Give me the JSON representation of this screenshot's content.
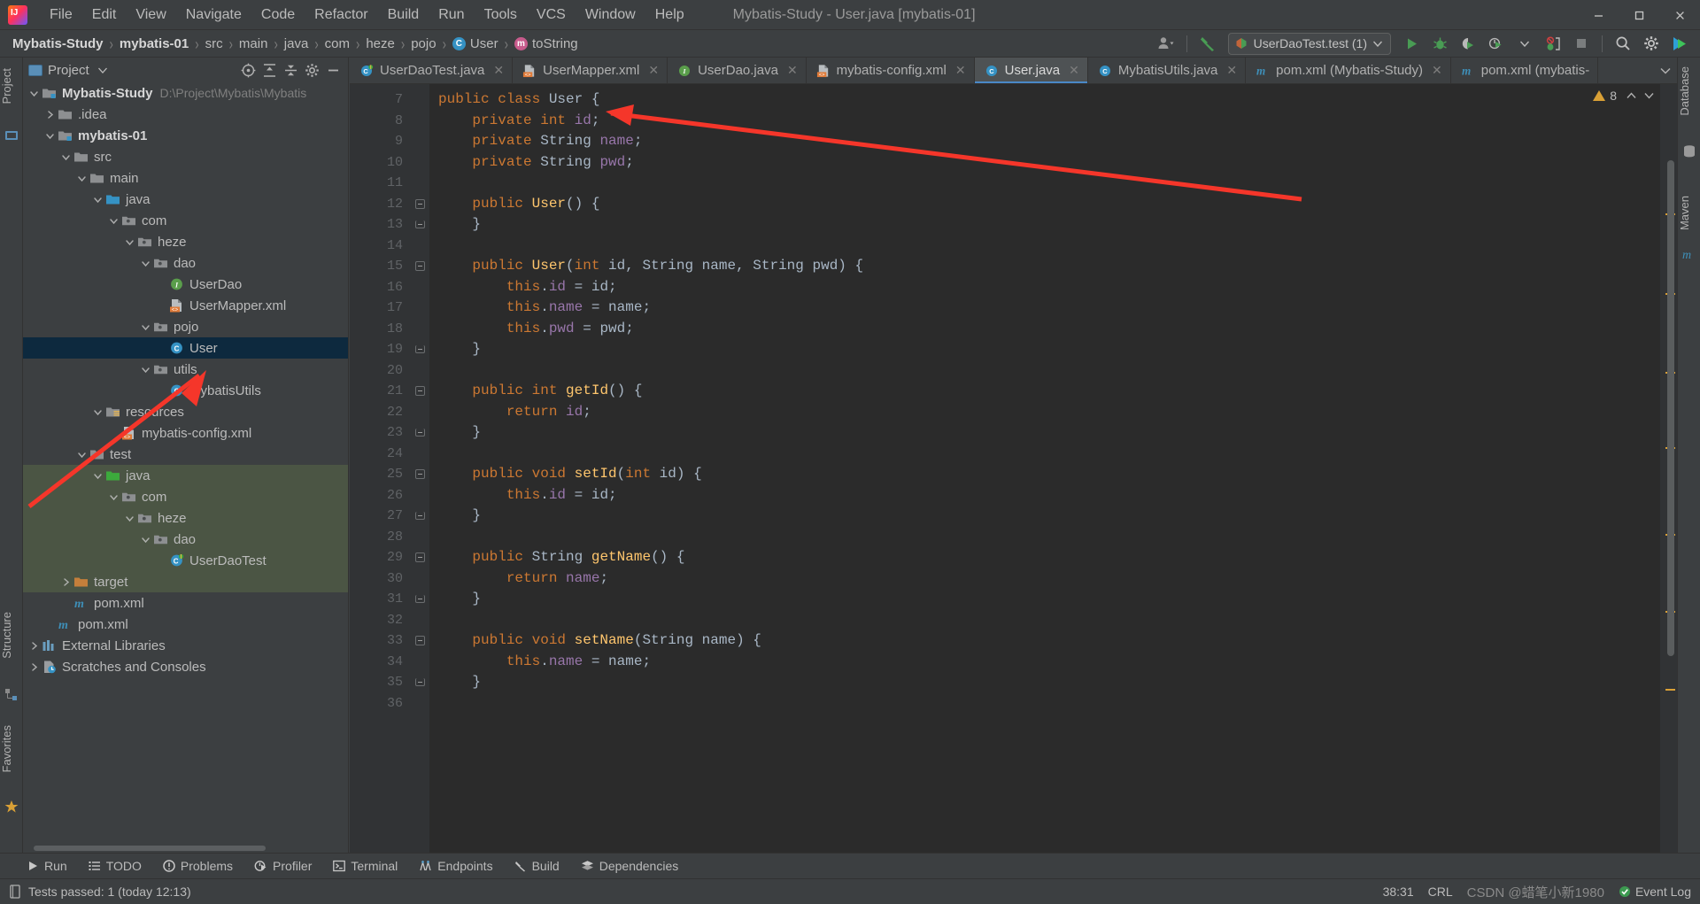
{
  "window": {
    "title": "Mybatis-Study - User.java [mybatis-01]",
    "minimize": "–",
    "maximize": "❐",
    "close": "✕"
  },
  "menu": [
    {
      "label": "File"
    },
    {
      "label": "Edit"
    },
    {
      "label": "View"
    },
    {
      "label": "Navigate"
    },
    {
      "label": "Code"
    },
    {
      "label": "Refactor"
    },
    {
      "label": "Build"
    },
    {
      "label": "Run"
    },
    {
      "label": "Tools"
    },
    {
      "label": "VCS"
    },
    {
      "label": "Window"
    },
    {
      "label": "Help"
    }
  ],
  "breadcrumb": [
    {
      "label": "Mybatis-Study",
      "icon": "none",
      "bold": true
    },
    {
      "label": "mybatis-01",
      "icon": "none",
      "bold": true
    },
    {
      "label": "src",
      "icon": "folder"
    },
    {
      "label": "main",
      "icon": "folder"
    },
    {
      "label": "java",
      "icon": "folder"
    },
    {
      "label": "com",
      "icon": "folder"
    },
    {
      "label": "heze",
      "icon": "folder"
    },
    {
      "label": "pojo",
      "icon": "folder"
    },
    {
      "label": "User",
      "icon": "class",
      "glyph": "C"
    },
    {
      "label": "toString",
      "icon": "method",
      "glyph": "m"
    }
  ],
  "run_toolbar": {
    "config_name": "UserDaoTest.test (1)",
    "run_tooltip": "Run",
    "debug_tooltip": "Debug",
    "coverage_tooltip": "Run with Coverage",
    "profiler_tooltip": "Profiler",
    "stop_tooltip": "Stop",
    "search_tooltip": "Search Everywhere",
    "settings_tooltip": "Settings"
  },
  "left_strip": [
    {
      "label": "Project"
    },
    {
      "label": "Structure"
    },
    {
      "label": "Favorites"
    }
  ],
  "right_strip": [
    {
      "label": "Database"
    },
    {
      "label": "Maven"
    }
  ],
  "project_panel": {
    "title": "Project",
    "actions": [
      "target-icon",
      "expand-all-icon",
      "collapse-all-icon",
      "settings-icon",
      "hide-icon"
    ]
  },
  "tree": [
    {
      "depth": 0,
      "chev": "down",
      "icon": "module",
      "label": "Mybatis-Study",
      "bold": true,
      "path": "D:\\Project\\Mybatis\\Mybatis"
    },
    {
      "depth": 1,
      "chev": "right",
      "icon": "folder",
      "label": ".idea"
    },
    {
      "depth": 1,
      "chev": "down",
      "icon": "module",
      "label": "mybatis-01",
      "bold": true
    },
    {
      "depth": 2,
      "chev": "down",
      "icon": "folder",
      "label": "src"
    },
    {
      "depth": 3,
      "chev": "down",
      "icon": "folder",
      "label": "main"
    },
    {
      "depth": 4,
      "chev": "down",
      "icon": "folder-src",
      "label": "java"
    },
    {
      "depth": 5,
      "chev": "down",
      "icon": "package",
      "label": "com"
    },
    {
      "depth": 6,
      "chev": "down",
      "icon": "package",
      "label": "heze"
    },
    {
      "depth": 7,
      "chev": "down",
      "icon": "package",
      "label": "dao"
    },
    {
      "depth": 8,
      "chev": "none",
      "icon": "interface",
      "label": "UserDao"
    },
    {
      "depth": 8,
      "chev": "none",
      "icon": "xml",
      "label": "UserMapper.xml"
    },
    {
      "depth": 7,
      "chev": "down",
      "icon": "package",
      "label": "pojo"
    },
    {
      "depth": 8,
      "chev": "none",
      "icon": "class",
      "label": "User",
      "selected": true
    },
    {
      "depth": 7,
      "chev": "down",
      "icon": "package",
      "label": "utils"
    },
    {
      "depth": 8,
      "chev": "none",
      "icon": "class",
      "label": "MybatisUtils"
    },
    {
      "depth": 4,
      "chev": "down",
      "icon": "folder-res",
      "label": "resources"
    },
    {
      "depth": 5,
      "chev": "none",
      "icon": "xml",
      "label": "mybatis-config.xml"
    },
    {
      "depth": 3,
      "chev": "down",
      "icon": "folder",
      "label": "test"
    },
    {
      "depth": 4,
      "chev": "down",
      "icon": "folder-test",
      "label": "java",
      "testbg": true
    },
    {
      "depth": 5,
      "chev": "down",
      "icon": "package",
      "label": "com",
      "testbg": true
    },
    {
      "depth": 6,
      "chev": "down",
      "icon": "package",
      "label": "heze",
      "testbg": true
    },
    {
      "depth": 7,
      "chev": "down",
      "icon": "package",
      "label": "dao",
      "testbg": true
    },
    {
      "depth": 8,
      "chev": "none",
      "icon": "testclass",
      "label": "UserDaoTest",
      "testbg": true
    },
    {
      "depth": 2,
      "chev": "right",
      "icon": "folder-target",
      "label": "target",
      "testbg": true
    },
    {
      "depth": 2,
      "chev": "none",
      "icon": "maven",
      "label": "pom.xml"
    },
    {
      "depth": 1,
      "chev": "none",
      "icon": "maven",
      "label": "pom.xml"
    },
    {
      "depth": 0,
      "chev": "right",
      "icon": "libs",
      "label": "External Libraries"
    },
    {
      "depth": 0,
      "chev": "right",
      "icon": "scratch",
      "label": "Scratches and Consoles"
    }
  ],
  "editor_tabs": [
    {
      "label": "UserDaoTest.java",
      "icon": "testclass",
      "closable": true,
      "active": false
    },
    {
      "label": "UserMapper.xml",
      "icon": "xml",
      "closable": true,
      "active": false
    },
    {
      "label": "UserDao.java",
      "icon": "interface",
      "closable": true,
      "active": false
    },
    {
      "label": "mybatis-config.xml",
      "icon": "xml",
      "closable": true,
      "active": false
    },
    {
      "label": "User.java",
      "icon": "class",
      "closable": true,
      "active": true
    },
    {
      "label": "MybatisUtils.java",
      "icon": "class",
      "closable": true,
      "active": false
    },
    {
      "label": "pom.xml (Mybatis-Study)",
      "icon": "maven",
      "closable": true,
      "active": false
    },
    {
      "label": "pom.xml (mybatis-",
      "icon": "maven",
      "closable": false,
      "active": false
    }
  ],
  "editor": {
    "first_line": 7,
    "warning_count": "8",
    "lines": [
      {
        "n": 7,
        "fold": "none",
        "html": "<span class=\"k\">public class </span><span class=\"cls\">User</span> {"
      },
      {
        "n": 8,
        "fold": "none",
        "html": "    <span class=\"k\">private int </span><span class=\"fld\">id</span>;"
      },
      {
        "n": 9,
        "fold": "none",
        "html": "    <span class=\"k\">private </span>String <span class=\"fld\">name</span>;"
      },
      {
        "n": 10,
        "fold": "none",
        "html": "    <span class=\"k\">private </span>String <span class=\"fld\">pwd</span>;"
      },
      {
        "n": 11,
        "fold": "none",
        "html": ""
      },
      {
        "n": 12,
        "fold": "start",
        "html": "    <span class=\"k\">public </span><span class=\"mth\">User</span>() {"
      },
      {
        "n": 13,
        "fold": "end",
        "html": "    }"
      },
      {
        "n": 14,
        "fold": "none",
        "html": ""
      },
      {
        "n": 15,
        "fold": "start",
        "html": "    <span class=\"k\">public </span><span class=\"mth\">User</span>(<span class=\"k\">int </span>id, String name, String pwd) {"
      },
      {
        "n": 16,
        "fold": "none",
        "html": "        <span class=\"k\">this</span>.<span class=\"fld\">id </span>= id;"
      },
      {
        "n": 17,
        "fold": "none",
        "html": "        <span class=\"k\">this</span>.<span class=\"fld\">name </span>= name;"
      },
      {
        "n": 18,
        "fold": "none",
        "html": "        <span class=\"k\">this</span>.<span class=\"fld\">pwd </span>= pwd;"
      },
      {
        "n": 19,
        "fold": "end",
        "html": "    }"
      },
      {
        "n": 20,
        "fold": "none",
        "html": ""
      },
      {
        "n": 21,
        "fold": "start",
        "html": "    <span class=\"k\">public int </span><span class=\"mth\">getId</span>() {"
      },
      {
        "n": 22,
        "fold": "none",
        "html": "        <span class=\"k\">return </span><span class=\"fld\">id</span>;"
      },
      {
        "n": 23,
        "fold": "end",
        "html": "    }"
      },
      {
        "n": 24,
        "fold": "none",
        "html": ""
      },
      {
        "n": 25,
        "fold": "start",
        "html": "    <span class=\"k\">public void </span><span class=\"mth\">setId</span>(<span class=\"k\">int </span>id) {"
      },
      {
        "n": 26,
        "fold": "none",
        "html": "        <span class=\"k\">this</span>.<span class=\"fld\">id </span>= id;"
      },
      {
        "n": 27,
        "fold": "end",
        "html": "    }"
      },
      {
        "n": 28,
        "fold": "none",
        "html": ""
      },
      {
        "n": 29,
        "fold": "start",
        "html": "    <span class=\"k\">public </span>String <span class=\"mth\">getName</span>() {"
      },
      {
        "n": 30,
        "fold": "none",
        "html": "        <span class=\"k\">return </span><span class=\"fld\">name</span>;"
      },
      {
        "n": 31,
        "fold": "end",
        "html": "    }"
      },
      {
        "n": 32,
        "fold": "none",
        "html": ""
      },
      {
        "n": 33,
        "fold": "start",
        "html": "    <span class=\"k\">public void </span><span class=\"mth\">setName</span>(String name) {"
      },
      {
        "n": 34,
        "fold": "none",
        "html": "        <span class=\"k\">this</span>.<span class=\"fld\">name </span>= name;"
      },
      {
        "n": 35,
        "fold": "end",
        "html": "    }"
      },
      {
        "n": 36,
        "fold": "none",
        "html": ""
      }
    ]
  },
  "bottom_tools": [
    {
      "label": "Run",
      "icon": "run-icon"
    },
    {
      "label": "TODO",
      "icon": "todo-icon"
    },
    {
      "label": "Problems",
      "icon": "problems-icon"
    },
    {
      "label": "Profiler",
      "icon": "profiler-icon"
    },
    {
      "label": "Terminal",
      "icon": "terminal-icon"
    },
    {
      "label": "Endpoints",
      "icon": "endpoints-icon"
    },
    {
      "label": "Build",
      "icon": "build-icon"
    },
    {
      "label": "Dependencies",
      "icon": "dependencies-icon"
    }
  ],
  "status_bar": {
    "message": "Tests passed: 1 (today 12:13)",
    "caret": "38:31",
    "line_sep": "CRL",
    "watermark": "CSDN @蜡笔小新1980",
    "event_log": "Event Log"
  },
  "colors": {
    "accent_blue": "#4a88c7",
    "selection": "#0d293e",
    "test_source": "#4b5544",
    "arrow_red": "#f5362a",
    "editor_bg": "#2b2b2b",
    "panel_bg": "#3c3f41"
  }
}
